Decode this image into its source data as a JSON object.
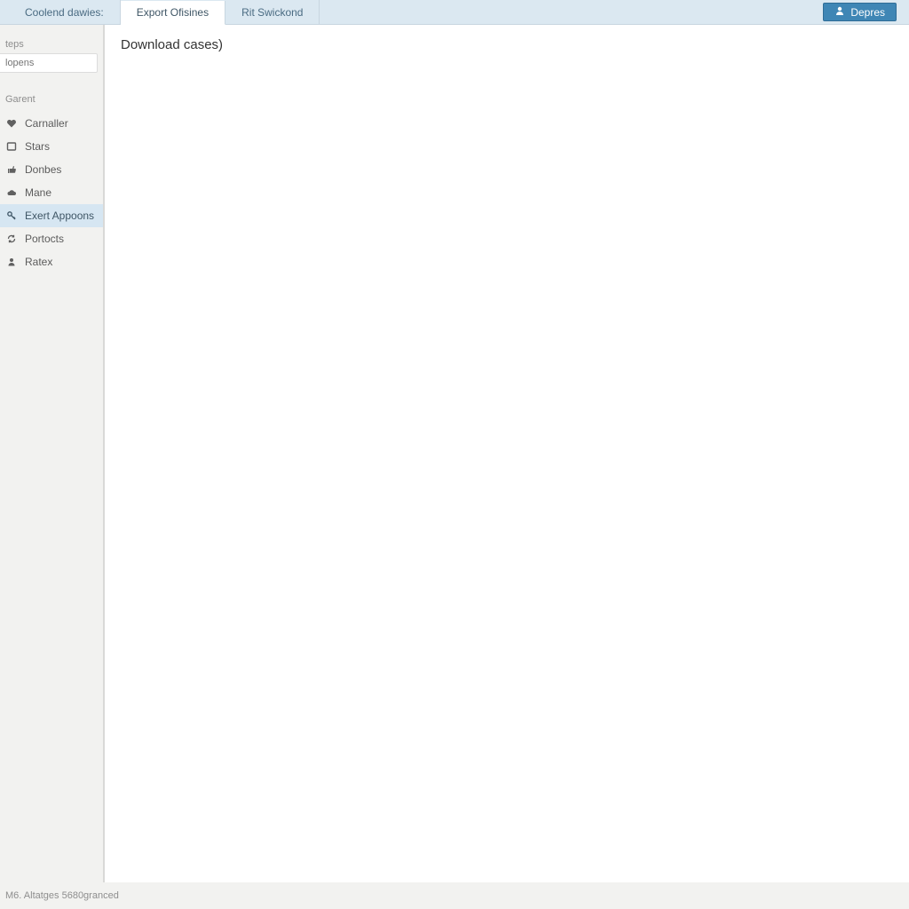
{
  "tabs": [
    {
      "label": "Coolend dawies:",
      "active": false
    },
    {
      "label": "Export Ofisines",
      "active": true
    },
    {
      "label": "Rit Swickond",
      "active": false
    }
  ],
  "header_button": {
    "label": "Depres"
  },
  "sidebar": {
    "search_section_label": "teps",
    "search_placeholder": "lopens",
    "nav_header": "Garent",
    "items": [
      {
        "label": "Carnaller",
        "icon": "heart",
        "selected": false
      },
      {
        "label": "Stars",
        "icon": "square",
        "selected": false
      },
      {
        "label": "Donbes",
        "icon": "thumbsup",
        "selected": false
      },
      {
        "label": "Mane",
        "icon": "cloud",
        "selected": false
      },
      {
        "label": "Exert Appoons",
        "icon": "key",
        "selected": true
      },
      {
        "label": "Portocts",
        "icon": "refresh",
        "selected": false
      },
      {
        "label": "Ratex",
        "icon": "person",
        "selected": false
      }
    ]
  },
  "main": {
    "title": "Download cases)"
  },
  "statusbar": {
    "text": "M6. Altatges 5680granced"
  }
}
